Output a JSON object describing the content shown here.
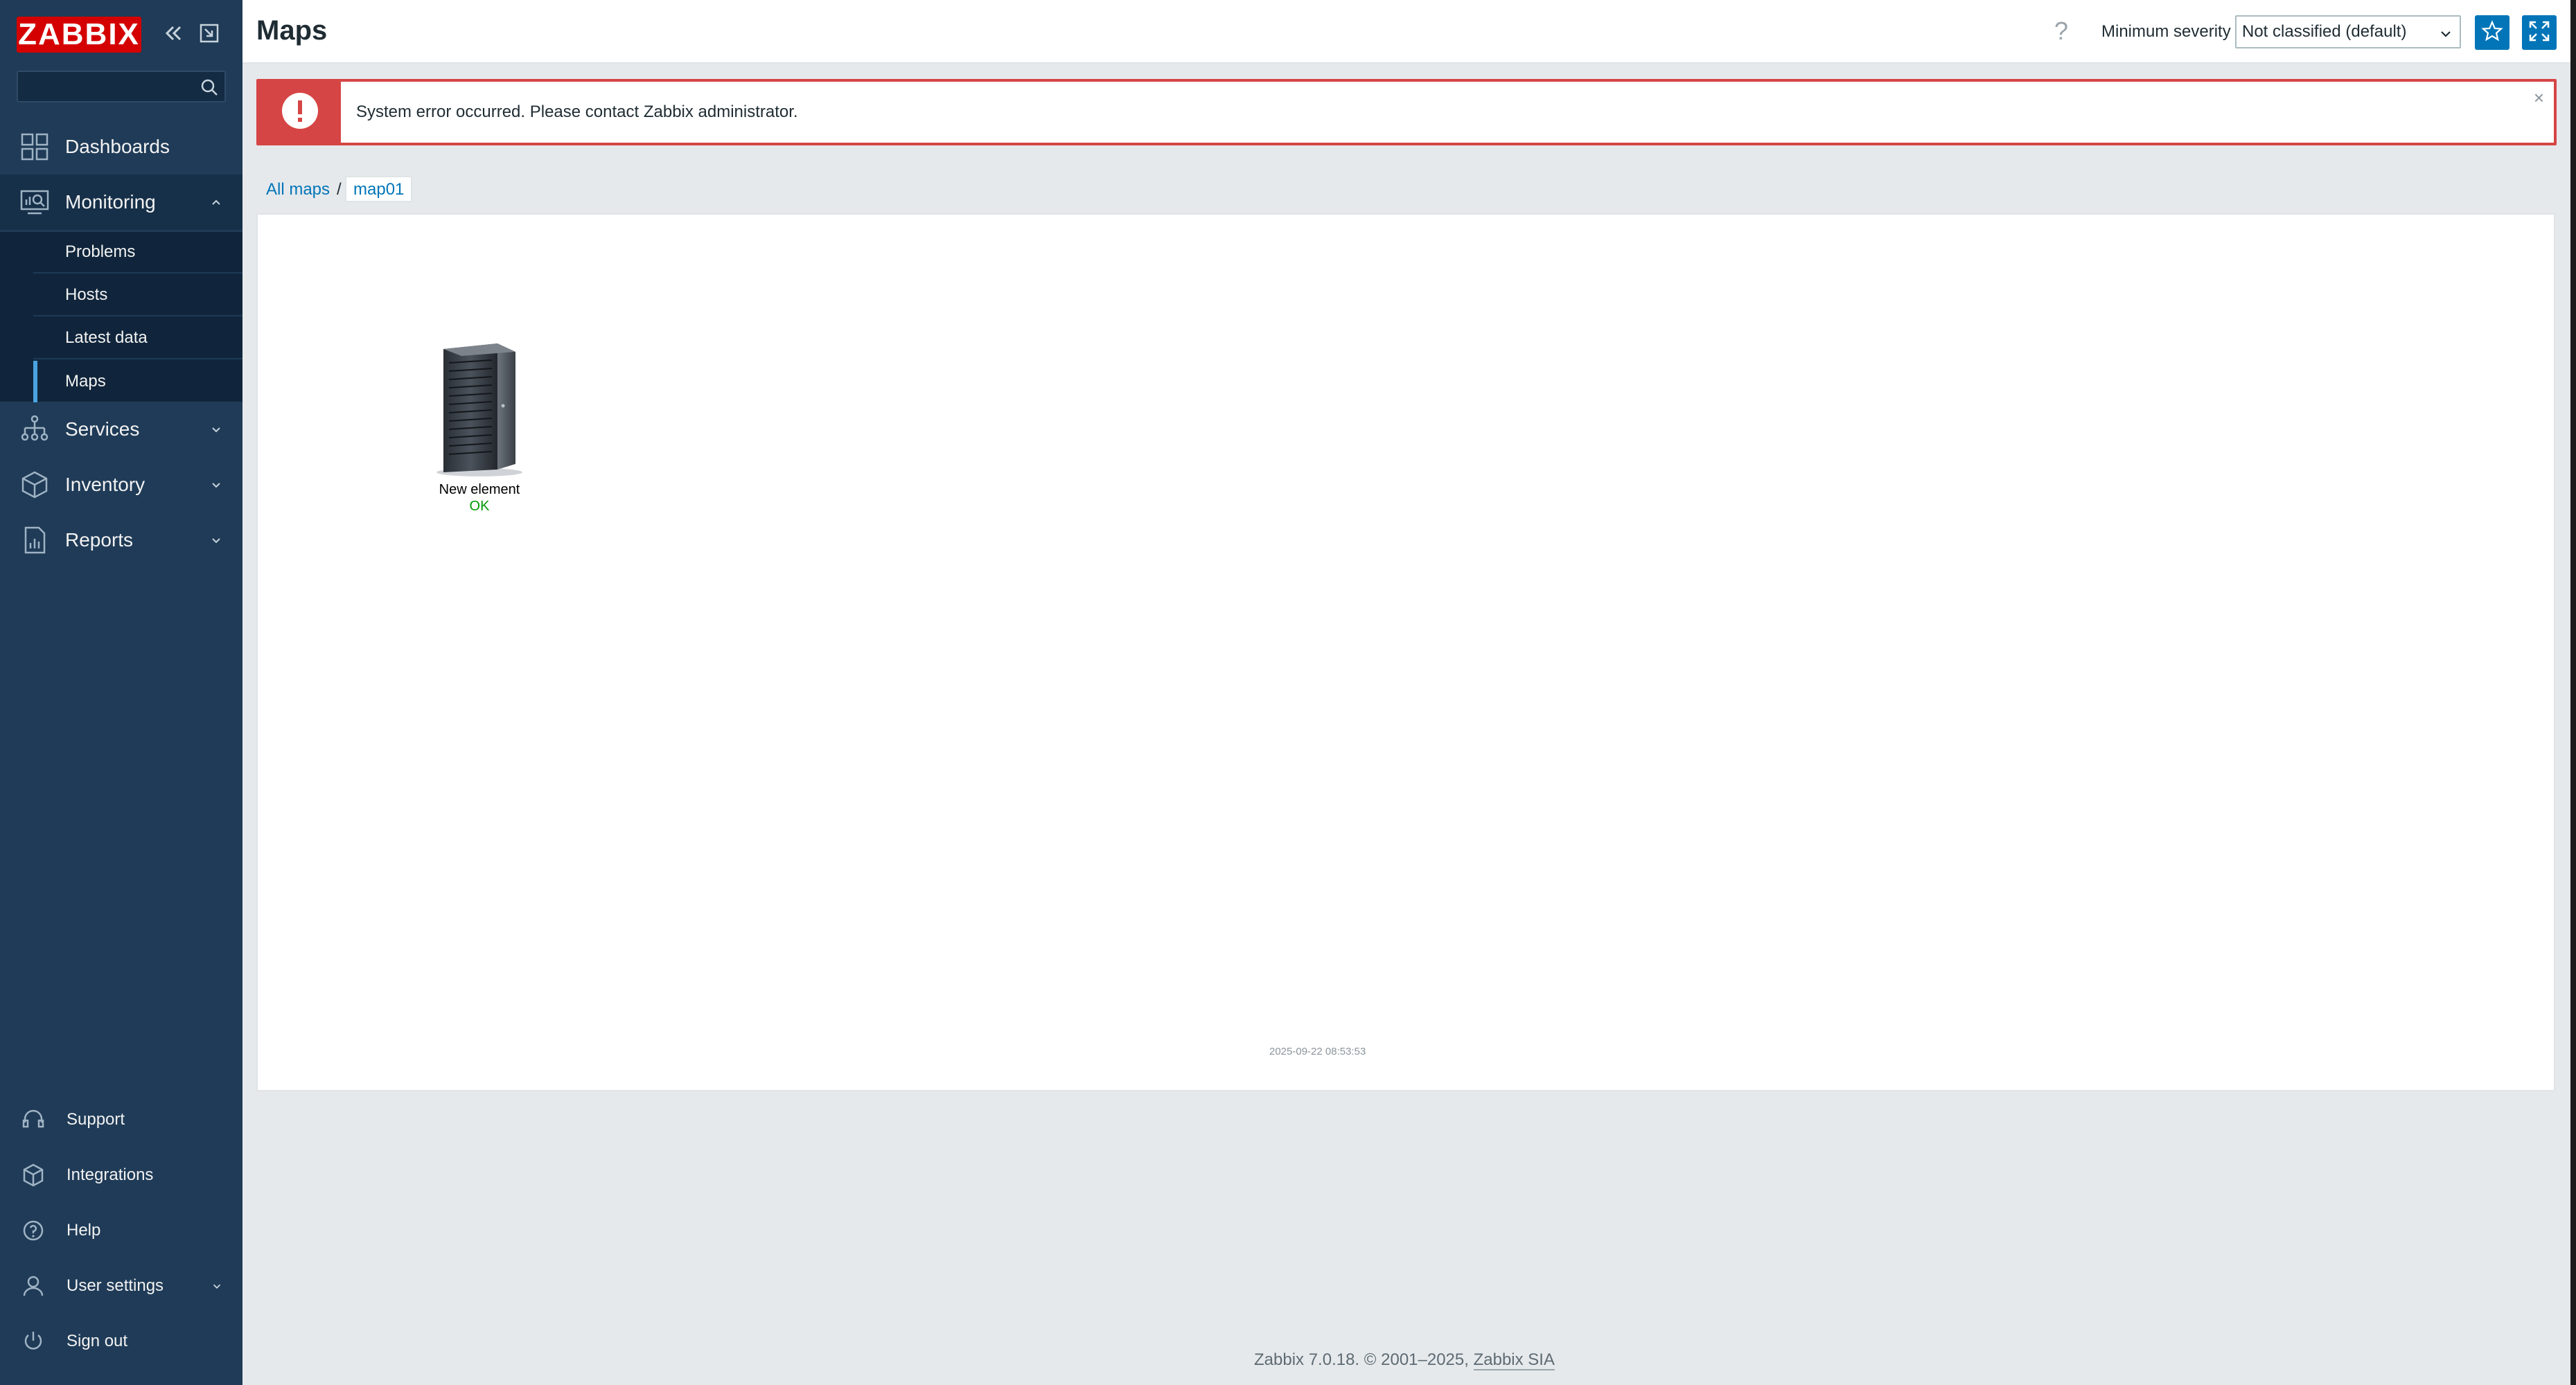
{
  "sidebar": {
    "logo": "ZABBIX",
    "search": {
      "placeholder": "",
      "value": ""
    },
    "menu": [
      {
        "id": "dashboards",
        "label": "Dashboards",
        "icon": "dashboards-icon"
      },
      {
        "id": "monitoring",
        "label": "Monitoring",
        "icon": "monitoring-icon",
        "expanded": true
      },
      {
        "id": "services",
        "label": "Services",
        "icon": "services-icon"
      },
      {
        "id": "inventory",
        "label": "Inventory",
        "icon": "inventory-icon"
      },
      {
        "id": "reports",
        "label": "Reports",
        "icon": "reports-icon"
      }
    ],
    "monitoring_submenu": [
      {
        "label": "Problems"
      },
      {
        "label": "Hosts"
      },
      {
        "label": "Latest data"
      },
      {
        "label": "Maps",
        "selected": true
      }
    ],
    "bottom": [
      {
        "label": "Support",
        "icon": "support-icon"
      },
      {
        "label": "Integrations",
        "icon": "integrations-icon"
      },
      {
        "label": "Help",
        "icon": "help-icon"
      },
      {
        "label": "User settings",
        "icon": "user-icon"
      },
      {
        "label": "Sign out",
        "icon": "power-icon"
      }
    ]
  },
  "header": {
    "title": "Maps",
    "help": "?",
    "severity_label": "Minimum severity",
    "severity_value": "Not classified (default)"
  },
  "error": {
    "message": "System error occurred. Please contact Zabbix administrator.",
    "close": "×"
  },
  "breadcrumb": {
    "all_maps": "All maps",
    "separator": "/",
    "current": "map01"
  },
  "map": {
    "element": {
      "label": "New element",
      "status": "OK"
    },
    "timestamp": "2025-09-22 08:53:53"
  },
  "footer": {
    "text": "Zabbix 7.0.18. © 2001–2025, ",
    "company": "Zabbix SIA"
  },
  "colors": {
    "sidebar_bg": "#1f3b57",
    "accent": "#0275b8",
    "error": "#d64545",
    "status_ok": "#009900",
    "logo": "#d40000"
  }
}
